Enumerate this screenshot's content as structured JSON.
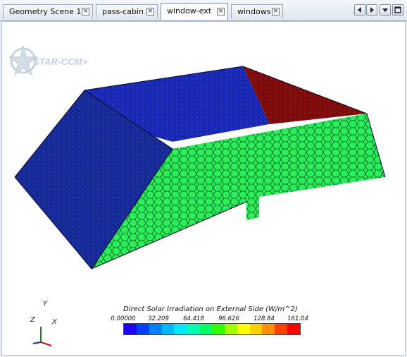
{
  "tabs": [
    {
      "label": "Geometry Scene 1",
      "active": false
    },
    {
      "label": "pass-cabin",
      "active": false
    },
    {
      "label": "window-ext",
      "active": true
    },
    {
      "label": "windows",
      "active": false
    }
  ],
  "tab_close_glyph": "×",
  "nav_buttons": [
    "scroll-left-icon",
    "scroll-right-icon",
    "tab-list-icon",
    "maximize-icon"
  ],
  "logo": {
    "text": "STAR-CCM+"
  },
  "triad": {
    "x": "X",
    "y": "Y",
    "z": "Z"
  },
  "legend": {
    "title": "Direct Solar Irradiation on External Side (W/m^2)",
    "ticks": [
      "0.00000",
      "32.209",
      "64.418",
      "96.626",
      "128.84",
      "161.04"
    ],
    "colors": [
      "#1e00ff",
      "#0040ff",
      "#0080ff",
      "#00b8ff",
      "#00e8ff",
      "#00ffb4",
      "#00ff60",
      "#30ff00",
      "#a0ff00",
      "#ffff00",
      "#ffd000",
      "#ff9000",
      "#ff4000",
      "#ff0000"
    ]
  },
  "surface_colors": {
    "left_panel": "#1a30a8",
    "back_panel": "#1e2ec8",
    "right_back_panel": "#8c0e0e",
    "front_panel": "#2aee5a"
  }
}
